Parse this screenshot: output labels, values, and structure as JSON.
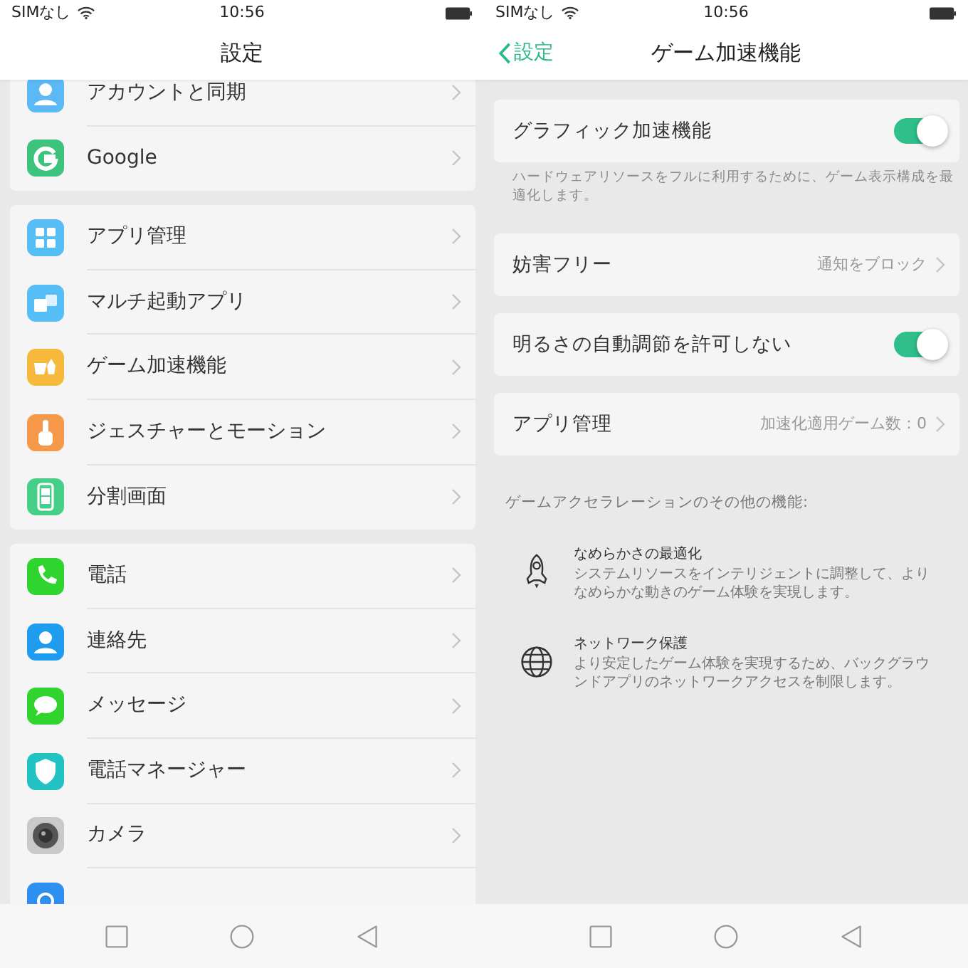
{
  "screens": [
    {
      "status_bar": {
        "carrier": "SIMなし",
        "time": "10:56"
      },
      "title": "設定",
      "groups": [
        {
          "items": [
            {
              "label": "アカウントと同期",
              "kind": "person",
              "color": "#5bb9f5"
            },
            {
              "label": "Google",
              "kind": "g",
              "color": "#3cc47c"
            }
          ]
        },
        {
          "items": [
            {
              "label": "アプリ管理",
              "kind": "grid",
              "color": "#56bdf6"
            },
            {
              "label": "マルチ起動アプリ",
              "kind": "clone",
              "color": "#56bdf6"
            },
            {
              "label": "ゲーム加速機能",
              "kind": "gamepad",
              "color": "#f6b93b"
            },
            {
              "label": "ジェスチャーとモーション",
              "kind": "finger",
              "color": "#f5984a"
            },
            {
              "label": "分割画面",
              "kind": "split",
              "color": "#45cf88"
            }
          ]
        },
        {
          "items": [
            {
              "label": "電話",
              "kind": "phone",
              "color": "#2fd42f"
            },
            {
              "label": "連絡先",
              "kind": "person",
              "color": "#1f9cf0"
            },
            {
              "label": "メッセージ",
              "kind": "bubble",
              "color": "#2fd42f"
            },
            {
              "label": "電話マネージャー",
              "kind": "shield",
              "color": "#21c2c2"
            },
            {
              "label": "カメラ",
              "kind": "lens",
              "color": "#c9c9c9"
            },
            {
              "kind": "weather",
              "color": "#2f8ff0"
            }
          ]
        }
      ]
    },
    {
      "status_bar": {
        "carrier": "SIMなし",
        "time": "10:56"
      },
      "back_label": "設定",
      "title": "ゲーム加速機能",
      "settings": [
        {
          "kind": "toggle",
          "label": "グラフィック加速機能",
          "on": true,
          "note": "ハードウェアリソースをフルに利用するために、ゲーム表示構成を最適化します。"
        },
        {
          "kind": "link",
          "label": "妨害フリー",
          "value": "通知をブロック"
        },
        {
          "kind": "toggle",
          "label": "明るさの自動調節を許可しない",
          "on": true
        },
        {
          "kind": "link",
          "label": "アプリ管理",
          "value": "加速化適用ゲーム数：0"
        }
      ],
      "section_title": "ゲームアクセラレーションのその他の機能:",
      "features": [
        {
          "kind": "rocket",
          "title": "なめらかさの最適化",
          "text": "システムリソースをインテリジェントに調整して、よりなめらかな動きのゲーム体験を実現します。"
        },
        {
          "kind": "globe",
          "title": "ネットワーク保護",
          "text": "より安定したゲーム体験を実現するため、バックグラウンドアプリのネットワークアクセスを制限します。"
        }
      ]
    }
  ]
}
